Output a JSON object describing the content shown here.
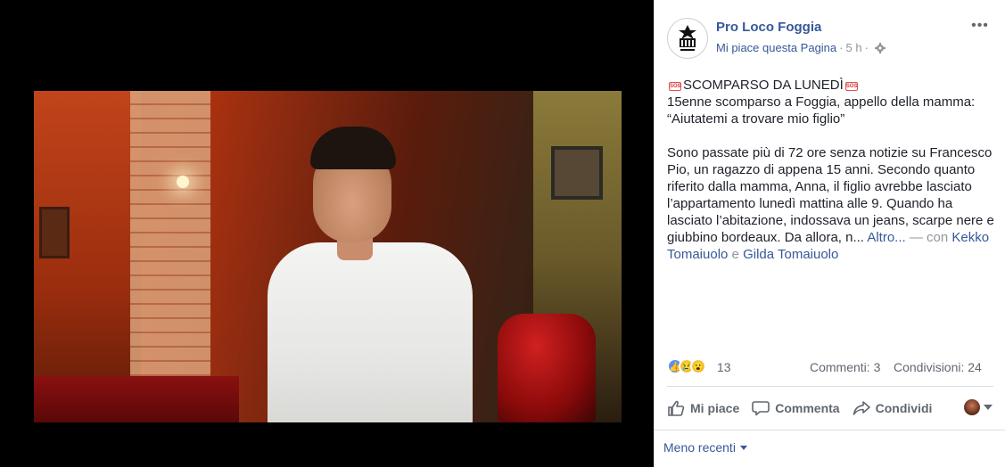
{
  "post": {
    "page_name": "Pro Loco Foggia",
    "like_page": "Mi piace questa Pagina",
    "separator": "·",
    "time": "5 h",
    "dot": "·",
    "more": "•••",
    "text": {
      "headline": "SCOMPARSO DA LUNEDÌ",
      "sos_badge": "SOS",
      "line2": "15enne scomparso a Foggia, appello della mamma: “Aiutatemi a trovare mio figlio”",
      "body": "Sono passate più di 72 ore senza notizie su Francesco Pio, un ragazzo di appena 15 anni. Secondo quanto riferito dalla mamma, Anna, il figlio avrebbe lasciato l’appartamento lunedì mattina alle 9. Quando ha lasciato l’abitazione, indossava un jeans, scarpe nere e giubbino bordeaux. Da allora, n...",
      "more_link": "Altro...",
      "with_prefix": "— con",
      "tag1": "Kekko Tomaiuolo",
      "conj": "e",
      "tag2": "Gilda Tomaiuolo"
    },
    "reactions": {
      "count": "13",
      "types": [
        "like-icon",
        "sad-icon",
        "wow-icon"
      ]
    },
    "comments": "Commenti: 3",
    "shares": "Condivisioni: 24",
    "actions": {
      "like": "Mi piace",
      "comment": "Commenta",
      "share": "Condividi"
    },
    "sort_label": "Meno recenti"
  },
  "colors": {
    "link": "#365899",
    "muted": "#90949c",
    "text": "#1d2129",
    "like_blue": "#5890ff",
    "reaction_yellow": "#f7c84a"
  }
}
